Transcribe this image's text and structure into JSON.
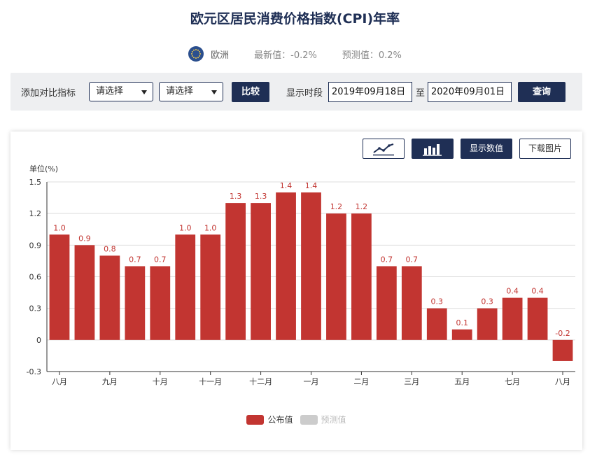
{
  "page": {
    "title": "欧元区居民消费价格指数(CPI)年率",
    "region": "欧洲",
    "latest": "最新值：-0.2%",
    "forecast": "预测值：0.2%"
  },
  "toolbar": {
    "compare_label": "添加对比指标",
    "select1": "请选择",
    "select2": "请选择",
    "compare_button": "比较",
    "period_label": "显示时段",
    "start_date": "2019年09月18日",
    "to": "至",
    "end_date": "2020年09月01日",
    "query_button": "查询"
  },
  "chart_tools": {
    "line_icon": "line-chart-icon",
    "bar_icon": "bar-chart-icon",
    "show_values": "显示数值",
    "download": "下载图片"
  },
  "colors": {
    "bar": "#c23531",
    "forecast": "#cccccc",
    "brand": "#1f2f55"
  },
  "chart_data": {
    "type": "bar",
    "ylabel": "单位(%)",
    "ylim": [
      -0.3,
      1.5
    ],
    "yticks": [
      -0.3,
      0,
      0.3,
      0.6,
      0.9,
      1.2,
      1.5
    ],
    "ytick_labels": [
      "-0.3",
      "0",
      "0.3",
      "0.6",
      "0.9",
      "1.2",
      "1.5"
    ],
    "values": [
      1.0,
      0.9,
      0.8,
      0.7,
      0.7,
      1.0,
      1.0,
      1.3,
      1.3,
      1.4,
      1.4,
      1.2,
      1.2,
      0.7,
      0.7,
      0.3,
      0.1,
      0.3,
      0.4,
      0.4,
      -0.2
    ],
    "value_labels": [
      "1.0",
      "0.9",
      "0.8",
      "0.7",
      "0.7",
      "1.0",
      "1.0",
      "1.3",
      "1.3",
      "1.4",
      "1.4",
      "1.2",
      "1.2",
      "0.7",
      "0.7",
      "0.3",
      "0.1",
      "0.3",
      "0.4",
      "0.4",
      "-0.2"
    ],
    "xtick_labels": [
      {
        "index": 0,
        "label": "八月"
      },
      {
        "index": 2,
        "label": "九月"
      },
      {
        "index": 4,
        "label": "十月"
      },
      {
        "index": 6,
        "label": "十一月"
      },
      {
        "index": 8,
        "label": "十二月"
      },
      {
        "index": 10,
        "label": "一月"
      },
      {
        "index": 12,
        "label": "二月"
      },
      {
        "index": 14,
        "label": "三月"
      },
      {
        "index": 16,
        "label": "五月"
      },
      {
        "index": 18,
        "label": "七月"
      },
      {
        "index": 20,
        "label": "八月"
      }
    ],
    "legend": [
      {
        "name": "公布值",
        "color": "#c23531",
        "active": true
      },
      {
        "name": "预测值",
        "color": "#cccccc",
        "active": false
      }
    ],
    "legend_position": "bottom-center",
    "grid": true
  }
}
